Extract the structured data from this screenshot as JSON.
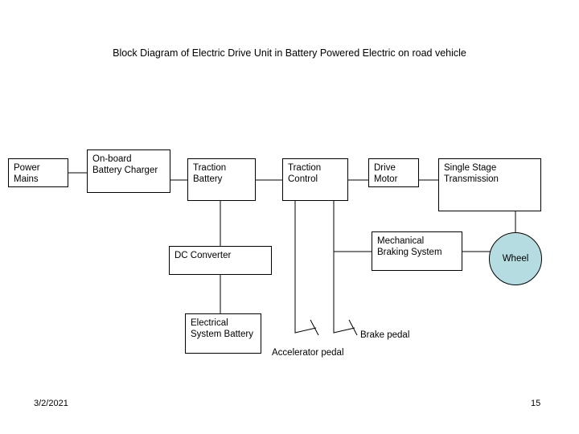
{
  "slide": {
    "title": "Block Diagram of Electric Drive Unit in Battery Powered Electric on road vehicle",
    "footer_date": "3/2/2021",
    "page_number": "15",
    "background_color": "#ffffff",
    "line_color": "#000000",
    "wheel_fill_color": "#b5dde1"
  },
  "nodes": {
    "power_mains": {
      "line1": "Power",
      "line2": "Mains"
    },
    "onboard_battery_charger": {
      "line1": "On-board",
      "line2": "Battery Charger"
    },
    "traction_battery": {
      "line1": "Traction",
      "line2": "Battery"
    },
    "traction_control": {
      "line1": "Traction",
      "line2": "Control"
    },
    "drive_motor": {
      "line1": "Drive",
      "line2": "Motor"
    },
    "single_stage_transmission": {
      "line1": "Single Stage",
      "line2": "Transmission"
    },
    "dc_converter": {
      "line1": "DC Converter",
      "line2": ""
    },
    "electrical_system_battery": {
      "line1": "Electrical",
      "line2": "System Battery"
    },
    "mechanical_braking_system": {
      "line1": "Mechanical",
      "line2": "Braking System"
    },
    "wheel": {
      "label": "Wheel"
    }
  },
  "labels": {
    "accelerator_pedal": "Accelerator pedal",
    "brake_pedal": "Brake pedal"
  }
}
